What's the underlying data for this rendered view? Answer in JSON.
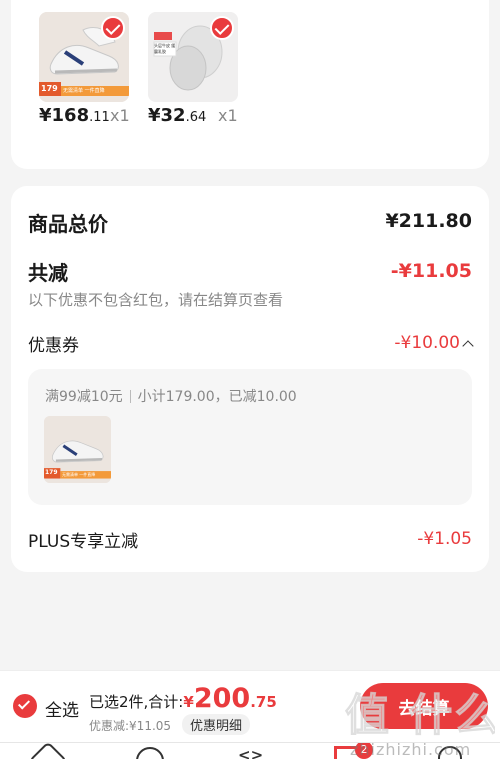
{
  "items": [
    {
      "price_int": "¥168",
      "price_dec": ".11",
      "qty": "x1",
      "badge_price": "179",
      "promo_text": "无需清单 一件直降"
    },
    {
      "price_int": "¥32",
      "price_dec": ".64",
      "qty": "x1",
      "promo_text": "头层牛皮 缓震乳胶"
    }
  ],
  "summary": {
    "total_label": "商品总价",
    "total_value": "¥211.80",
    "reduce_label": "共减",
    "reduce_value": "-¥11.05",
    "reduce_note": "以下优惠不包含红包，请在结算页查看",
    "coupon_label": "优惠券",
    "coupon_value": "-¥10.00",
    "coupon_detail_rule": "满99减10元",
    "coupon_detail_info": "小计179.00，已减10.00",
    "coupon_item_badge": "179",
    "coupon_item_promo": "无需清单 一件直降",
    "plus_label": "PLUS专享立减",
    "plus_value": "-¥1.05"
  },
  "bottom": {
    "select_all": "全选",
    "selected_text": "已选2件,合计:",
    "total_symbol": "¥",
    "total_int": "200",
    "total_dec": ".75",
    "discount_text": "优惠减:¥11.05",
    "detail_button": "优惠明细",
    "checkout_button": "去结算",
    "watermark": "值 什么值得买",
    "watermark_url": "zhizhizhi.com",
    "cart_badge": "2"
  },
  "colors": {
    "accent": "#e93b3d",
    "text": "#1a1a1a",
    "muted": "#888888"
  }
}
